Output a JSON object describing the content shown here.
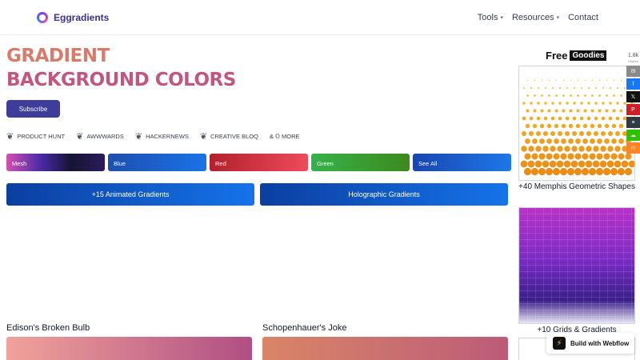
{
  "header": {
    "brand": "Eggradients",
    "nav": [
      {
        "label": "Tools",
        "dropdown": true
      },
      {
        "label": "Resources",
        "dropdown": true
      },
      {
        "label": "Contact",
        "dropdown": false
      }
    ]
  },
  "hero": {
    "title_line1": "GRADIENT",
    "title_line2": "BACKGROUND COLORS",
    "subscribe_label": "Subscribe"
  },
  "awards": [
    "PRODUCT HUNT",
    "AWWWARDS",
    "HACKERNEWS",
    "CREATIVE BLOQ"
  ],
  "more_label": "& 𝕆 MORE",
  "chips": [
    {
      "label": "Mesh"
    },
    {
      "label": "Blue"
    },
    {
      "label": "Red"
    },
    {
      "label": "Green"
    },
    {
      "label": "See All"
    }
  ],
  "buttons": {
    "animated": "+15 Animated Gradients",
    "holographic": "Holographic Gradients"
  },
  "cards": [
    {
      "title": "Edison's Broken Bulb"
    },
    {
      "title": "Schopenhauer's Joke"
    }
  ],
  "sidebar": {
    "heading_free": "Free",
    "heading_goodies": "Goodies",
    "caption_1": "+40 Memphis Geometric Shapes",
    "caption_2": "+10 Grids & Gradients"
  },
  "share": {
    "count": "1.8k",
    "label": "Shares",
    "buttons": [
      {
        "icon": "email-icon",
        "glyph": "✉",
        "color": "#8a8a8a"
      },
      {
        "icon": "facebook-icon",
        "glyph": "f",
        "color": "#1877f2"
      },
      {
        "icon": "x-icon",
        "glyph": "𝕏",
        "color": "#111111"
      },
      {
        "icon": "pinterest-icon",
        "glyph": "P",
        "color": "#cb2027"
      },
      {
        "icon": "buffer-icon",
        "glyph": "≡",
        "color": "#323b43"
      },
      {
        "icon": "wechat-icon",
        "glyph": "☁",
        "color": "#2dc100"
      },
      {
        "icon": "mix-icon",
        "glyph": "m",
        "color": "#ff8226"
      }
    ]
  },
  "webflow_label": "Build with Webflow"
}
